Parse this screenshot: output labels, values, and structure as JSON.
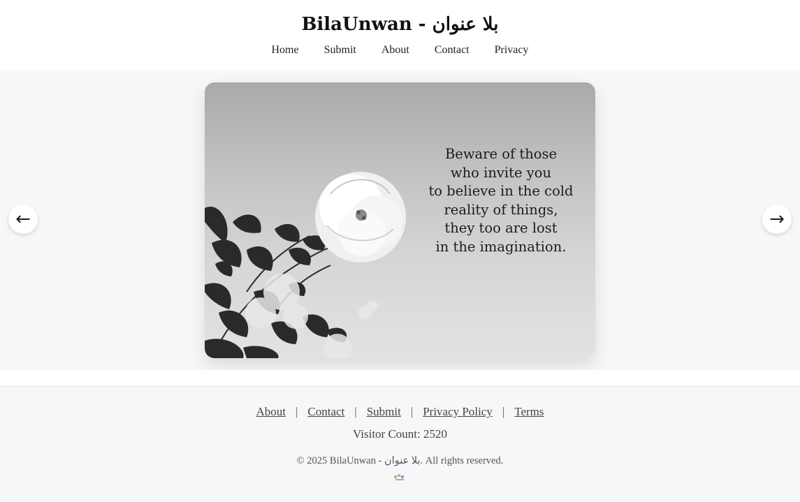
{
  "header": {
    "title": "BilaUnwan - بلا عنوان",
    "nav": [
      "Home",
      "Submit",
      "About",
      "Contact",
      "Privacy"
    ]
  },
  "carousel": {
    "quote_lines": [
      "Beware of those",
      "who invite you",
      "to believe in the cold",
      "reality of things,",
      "they too are lost",
      "in the imagination."
    ],
    "prev_icon": "←",
    "next_icon": "→"
  },
  "footer": {
    "links": [
      "About",
      "Contact",
      "Submit",
      "Privacy Policy",
      "Terms"
    ],
    "separator": "|",
    "visitor_count": "Visitor Count: 2520",
    "copyright": "© 2025 BilaUnwan - بلا عنوان. All rights reserved."
  },
  "colors": {
    "page_bg": "#f6f7f8",
    "header_bg": "#ffffff",
    "text": "#222222"
  }
}
